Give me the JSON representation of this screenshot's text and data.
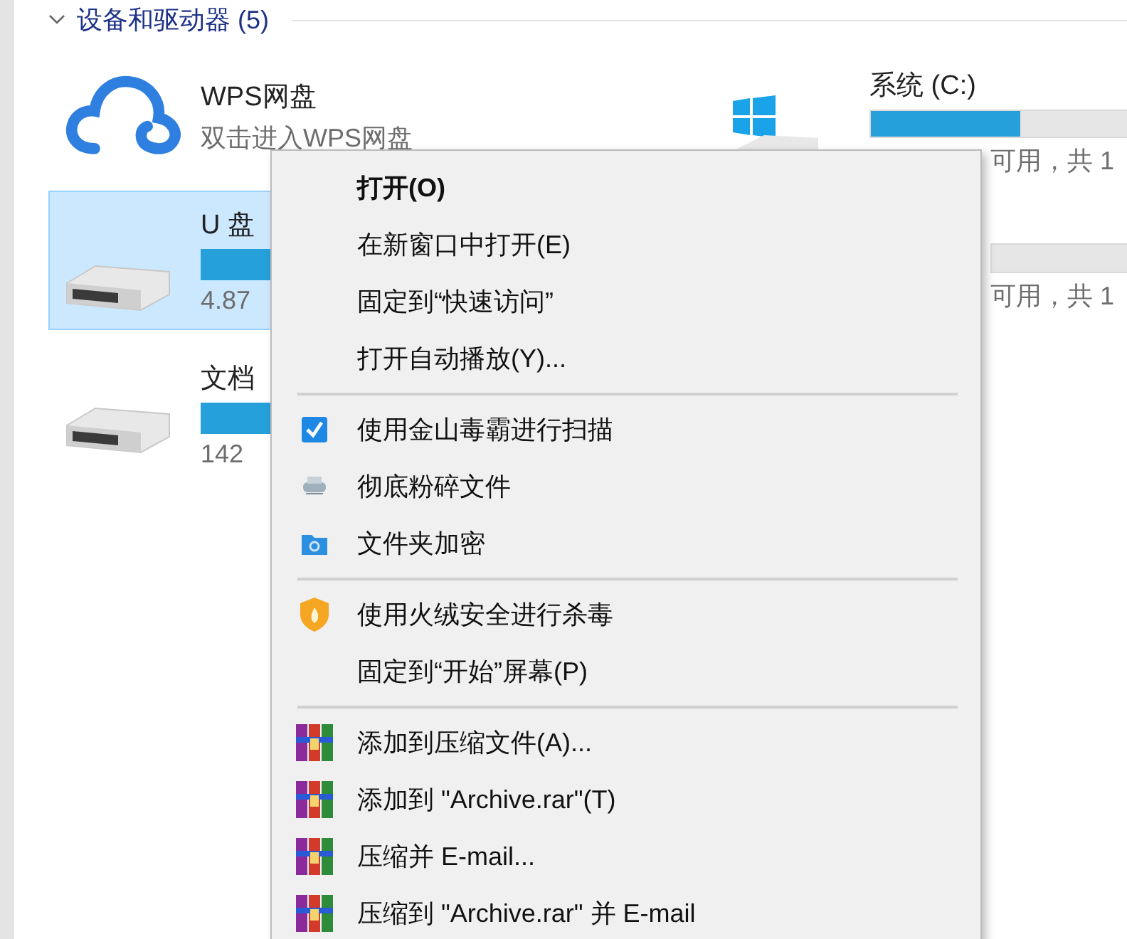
{
  "section": {
    "title": "设备和驱动器 (5)",
    "expanded": true
  },
  "columns": [
    [
      {
        "kind": "cloud",
        "name": "WPS网盘",
        "subtitle": "双击进入WPS网盘",
        "selected": false
      },
      {
        "kind": "drive",
        "name": "U 盘",
        "detail": "4.87",
        "selected": true
      },
      {
        "kind": "drive",
        "name": "文档",
        "detail": "142",
        "selected": false
      }
    ],
    [
      {
        "kind": "system",
        "name": "系统 (C:)",
        "level": 0.56,
        "detail": "可用，共 1",
        "selected": false
      },
      {
        "kind": "hidden",
        "detail": "可用，共 1",
        "selected": false
      }
    ]
  ],
  "context_menu": [
    {
      "kind": "plain",
      "label": "打开(O)",
      "bold": true
    },
    {
      "kind": "plain",
      "label": "在新窗口中打开(E)",
      "bold": false
    },
    {
      "kind": "plain",
      "label": "固定到“快速访问”",
      "bold": false
    },
    {
      "kind": "plain",
      "label": "打开自动播放(Y)...",
      "bold": false
    },
    {
      "kind": "separator"
    },
    {
      "kind": "scan",
      "label": "使用金山毒霸进行扫描",
      "bold": false
    },
    {
      "kind": "shredder",
      "label": "彻底粉碎文件",
      "bold": false
    },
    {
      "kind": "folder",
      "label": "文件夹加密",
      "bold": false
    },
    {
      "kind": "separator"
    },
    {
      "kind": "shield",
      "label": "使用火绒安全进行杀毒",
      "bold": false
    },
    {
      "kind": "plain",
      "label": "固定到“开始”屏幕(P)",
      "bold": false
    },
    {
      "kind": "separator"
    },
    {
      "kind": "archive",
      "label": "添加到压缩文件(A)...",
      "bold": false
    },
    {
      "kind": "archive",
      "label": "添加到 \"Archive.rar\"(T)",
      "bold": false
    },
    {
      "kind": "archive",
      "label": "压缩并 E-mail...",
      "bold": false
    },
    {
      "kind": "archive",
      "label": "压缩到 \"Archive.rar\" 并 E-mail",
      "bold": false
    }
  ]
}
